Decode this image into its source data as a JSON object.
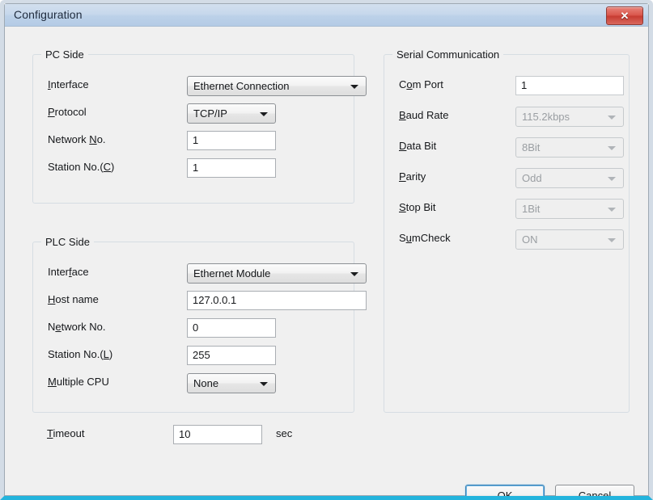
{
  "window": {
    "title": "Configuration",
    "close_icon": "close-icon",
    "close_glyph": "✕"
  },
  "pc_side": {
    "legend": "PC Side",
    "fields": [
      {
        "label_pre": "",
        "label_mn": "I",
        "label_post": "nterface",
        "type": "combo",
        "value": "Ethernet Connection",
        "enabled": true
      },
      {
        "label_pre": "",
        "label_mn": "P",
        "label_post": "rotocol",
        "type": "combo",
        "value": "TCP/IP",
        "enabled": true
      },
      {
        "label_pre": "Network ",
        "label_mn": "N",
        "label_post": "o.",
        "type": "text",
        "value": "1",
        "enabled": true
      },
      {
        "label_pre": "Station No.(",
        "label_mn": "C",
        "label_post": ")",
        "type": "text",
        "value": "1",
        "enabled": true
      }
    ]
  },
  "plc_side": {
    "legend": "PLC Side",
    "fields": [
      {
        "label_pre": "Inter",
        "label_mn": "f",
        "label_post": "ace",
        "type": "combo",
        "value": "Ethernet Module",
        "enabled": true
      },
      {
        "label_pre": "",
        "label_mn": "H",
        "label_post": "ost name",
        "type": "text",
        "value": "127.0.0.1",
        "enabled": true
      },
      {
        "label_pre": "N",
        "label_mn": "e",
        "label_post": "twork No.",
        "type": "text",
        "value": "0",
        "enabled": true
      },
      {
        "label_pre": "Station No.(",
        "label_mn": "L",
        "label_post": ")",
        "type": "text",
        "value": "255",
        "enabled": true
      },
      {
        "label_pre": "",
        "label_mn": "M",
        "label_post": "ultiple CPU",
        "type": "combo",
        "value": "None",
        "enabled": true
      }
    ]
  },
  "timeout": {
    "label_pre": "",
    "label_mn": "T",
    "label_post": "imeout",
    "value": "10",
    "unit": "sec"
  },
  "serial": {
    "legend": "Serial Communication",
    "fields": [
      {
        "label_pre": "C",
        "label_mn": "o",
        "label_post": "m Port",
        "type": "text",
        "value": "1",
        "enabled": false
      },
      {
        "label_pre": "",
        "label_mn": "B",
        "label_post": "aud Rate",
        "type": "combo",
        "value": "115.2kbps",
        "enabled": false
      },
      {
        "label_pre": "",
        "label_mn": "D",
        "label_post": "ata Bit",
        "type": "combo",
        "value": "8Bit",
        "enabled": false
      },
      {
        "label_pre": "",
        "label_mn": "P",
        "label_post": "arity",
        "type": "combo",
        "value": "Odd",
        "enabled": false
      },
      {
        "label_pre": "",
        "label_mn": "S",
        "label_post": "top Bit",
        "type": "combo",
        "value": "1Bit",
        "enabled": false
      },
      {
        "label_pre": "S",
        "label_mn": "u",
        "label_post": "mCheck",
        "type": "combo",
        "value": "ON",
        "enabled": false
      }
    ]
  },
  "buttons": {
    "ok": "OK",
    "cancel": "Cancel"
  },
  "colors": {
    "titlebar": "#c7d8ec",
    "surface": "#f0f0f0",
    "accent_bottom": "#23b4dd",
    "close_red": "#d9564b",
    "default_focus": "#3c7fb1"
  }
}
